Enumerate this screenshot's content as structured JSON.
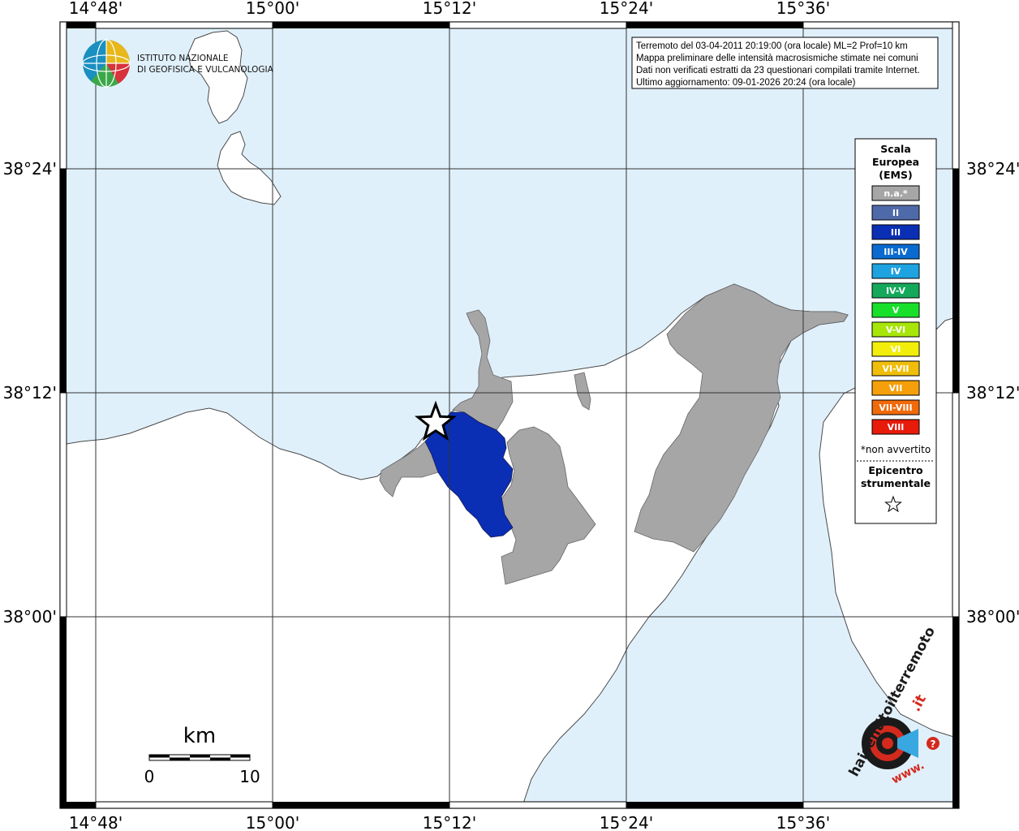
{
  "info_box": {
    "line1": "Terremoto del 03-04-2011 20:19:00 (ora locale) ML=2 Prof=10 km",
    "line2": "Mappa preliminare delle intensità macrosismiche stimate nei comuni",
    "line3": "Dati non verificati estratti da 23 questionari compilati tramite Internet.",
    "line4": "Ultimo aggiornamento: 09-01-2026 20:24 (ora locale)"
  },
  "axes": {
    "lon_labels": [
      "14°48'",
      "15°00'",
      "15°12'",
      "15°24'",
      "15°36'"
    ],
    "lat_labels": [
      "38°24'",
      "38°12'",
      "38°00'"
    ]
  },
  "logo": {
    "line1": "ISTITUTO NAZIONALE",
    "line2": "DI GEOFISICA E VULCANOLOGIA"
  },
  "legend": {
    "title1": "Scala",
    "title2": "Europea",
    "title3": "(EMS)",
    "items": [
      {
        "label": "n.a.*",
        "color": "#a6a6a6"
      },
      {
        "label": "II",
        "color": "#4f6aa8"
      },
      {
        "label": "III",
        "color": "#0a2fb5"
      },
      {
        "label": "III-IV",
        "color": "#0a6ad0"
      },
      {
        "label": "IV",
        "color": "#1ea3e0"
      },
      {
        "label": "IV-V",
        "color": "#14a85a"
      },
      {
        "label": "V",
        "color": "#18e02a"
      },
      {
        "label": "V-VI",
        "color": "#a8e60a"
      },
      {
        "label": "VI",
        "color": "#f2ee0a"
      },
      {
        "label": "VI-VII",
        "color": "#f0be0a"
      },
      {
        "label": "VII",
        "color": "#f5a00a"
      },
      {
        "label": "VII-VIII",
        "color": "#f06a0a"
      },
      {
        "label": "VIII",
        "color": "#e81a0a"
      }
    ],
    "note": "*non avvertito",
    "epicenter_line1": "Epicentro",
    "epicenter_line2": "strumentale"
  },
  "scale_bar": {
    "unit": "km",
    "min_label": "0",
    "max_label": "10"
  },
  "brand": {
    "text_main": "haisentitoilterremoto",
    "text_suffix": ".it",
    "text_prefix": "www."
  },
  "colors": {
    "sea": "#e0f0fb",
    "land": "#ffffff",
    "na": "#a6a6a6",
    "intensity_III": "#0a2fb5"
  }
}
